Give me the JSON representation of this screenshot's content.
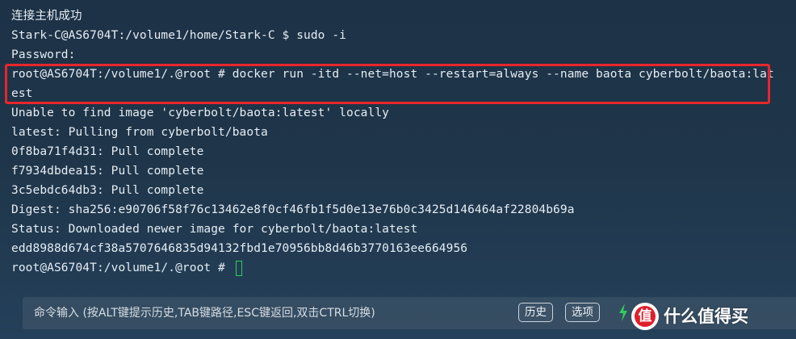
{
  "terminal": {
    "lines": [
      "连接主机成功",
      "Stark-C@AS6704T:/volume1/home/Stark-C $ sudo -i",
      "Password:",
      "root@AS6704T:/volume1/.@root # docker run -itd --net=host --restart=always --name baota cyberbolt/baota:lat",
      "est",
      "Unable to find image 'cyberbolt/baota:latest' locally",
      "latest: Pulling from cyberbolt/baota",
      "0f8ba71f4d31: Pull complete",
      "f7934dbdea15: Pull complete",
      "3c5ebdc64db3: Pull complete",
      "Digest: sha256:e90706f58f76c13462e8f0cf46fb1f5d0e13e76b0c3425d146464af22804b69a",
      "Status: Downloaded newer image for cyberbolt/baota:latest",
      "edd8988d674cf38a5707646835d94132fbd1e70956bb8d46b3770163ee664956"
    ],
    "prompt": "root@AS6704T:/volume1/.@root # "
  },
  "command_bar": {
    "placeholder": "命令输入 (按ALT键提示历史,TAB键路径,ESC键返回,双击CTRL切换)",
    "history_label": "历史",
    "options_label": "选项"
  },
  "icons": {
    "bolt": "lightning-bolt-icon",
    "copy": "copy-icon"
  },
  "watermark": {
    "logo_char": "值",
    "text": "什么值得买"
  },
  "colors": {
    "highlight": "#e8262b",
    "cursor": "#2fd05a",
    "bolt": "#2fd05a"
  }
}
